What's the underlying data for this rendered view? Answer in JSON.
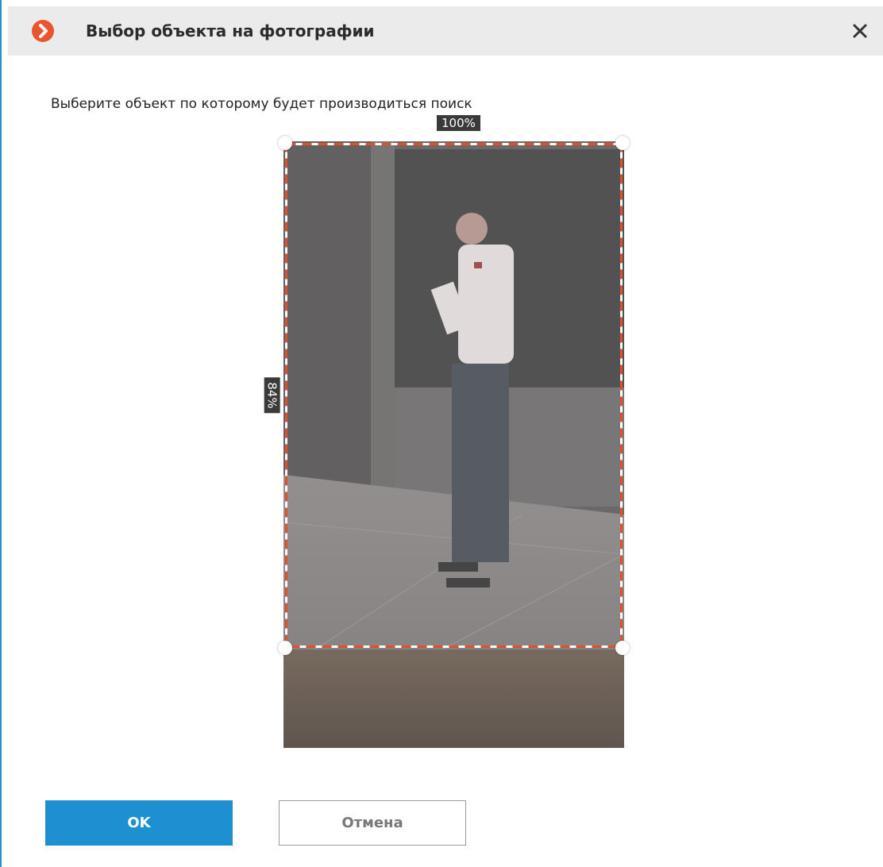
{
  "dialog": {
    "title": "Выбор объекта на фотографии",
    "app_icon": "chevron-right-icon",
    "close_icon": "close-icon",
    "instruction": "Выберите объект по которому будет производиться поиск"
  },
  "selection": {
    "width_label": "100%",
    "height_label": "84%",
    "width_percent": 100,
    "height_percent": 84,
    "border_color": "#e0502e"
  },
  "buttons": {
    "ok_label": "OK",
    "cancel_label": "Отмена"
  },
  "colors": {
    "accent": "#1e8fd0",
    "brand": "#e8552e"
  }
}
